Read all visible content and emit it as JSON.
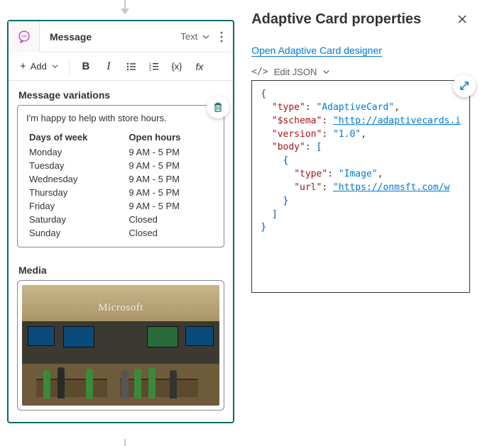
{
  "node": {
    "title": "Message",
    "type_label": "Text",
    "add_label": "Add"
  },
  "toolbar": {
    "bold": "B",
    "italic": "I",
    "expr": "{x}",
    "fx": "fx"
  },
  "sections": {
    "variations_label": "Message variations",
    "intro_text": "I'm happy to help with store hours.",
    "hours_header_day": "Days of week",
    "hours_header_open": "Open hours",
    "hours": [
      {
        "day": "Monday",
        "open": "9 AM - 5 PM"
      },
      {
        "day": "Tuesday",
        "open": "9 AM - 5 PM"
      },
      {
        "day": "Wednesday",
        "open": "9 AM - 5 PM"
      },
      {
        "day": "Thursday",
        "open": "9 AM - 5 PM"
      },
      {
        "day": "Friday",
        "open": "9 AM - 5 PM"
      },
      {
        "day": "Saturday",
        "open": "Closed"
      },
      {
        "day": "Sunday",
        "open": "Closed"
      }
    ],
    "media_label": "Media",
    "media_logo": "Microsoft"
  },
  "panel": {
    "title": "Adaptive Card properties",
    "designer_link": "Open Adaptive Card designer",
    "edit_json_label": "Edit JSON",
    "json": {
      "l1": "{",
      "l2_k": "\"type\"",
      "l2_v": "\"AdaptiveCard\"",
      "l3_k": "\"$schema\"",
      "l3_v": "\"http://adaptivecards.i",
      "l4_k": "\"version\"",
      "l4_v": "\"1.0\"",
      "l5_k": "\"body\"",
      "l5_v": "[",
      "l6": "{",
      "l7_k": "\"type\"",
      "l7_v": "\"Image\"",
      "l8_k": "\"url\"",
      "l8_v": "\"https://onmsft.com/w",
      "l9": "}",
      "l10": "]",
      "l11": "}"
    }
  }
}
